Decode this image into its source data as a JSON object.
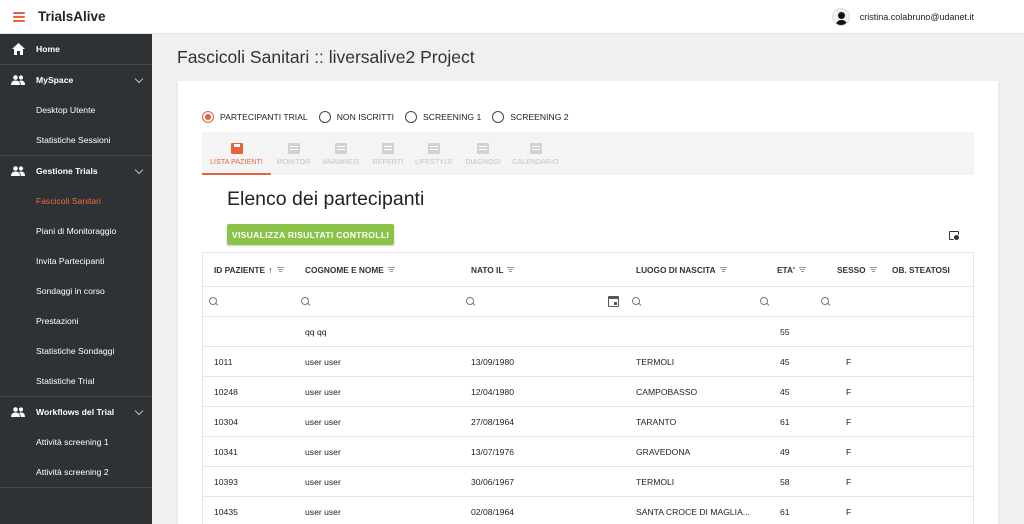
{
  "app": {
    "title": "TrialsAlive"
  },
  "user": {
    "email": "cristina.colabruno@udanet.it"
  },
  "sidebar": {
    "home": "Home",
    "myspace": {
      "label": "MySpace",
      "items": [
        "Desktop Utente",
        "Statistiche Sessioni"
      ]
    },
    "gestione": {
      "label": "Gestione Trials",
      "items": [
        "Fascicoli Sanitari",
        "Piani di Monitoraggio",
        "Invita Partecipanti",
        "Sondaggi in corso",
        "Prestazioni",
        "Statistiche Sondaggi",
        "Statistiche Trial"
      ],
      "active": "Fascicoli Sanitari"
    },
    "workflows": {
      "label": "Workflows del Trial",
      "items": [
        "Attività screening 1",
        "Attività screening 2"
      ]
    }
  },
  "page": {
    "title": "Fascicoli Sanitari :: liversalive2 Project"
  },
  "filters": {
    "options": [
      "PARTECIPANTI TRIAL",
      "NON ISCRITTI",
      "SCREENING 1",
      "SCREENING 2"
    ],
    "selected": "PARTECIPANTI TRIAL"
  },
  "tabs": {
    "items": [
      "LISTA PAZIENTI",
      "MONITOR",
      "ANAMNESI",
      "REFERTI",
      "LIFESTYLE",
      "DIAGNOSI",
      "CALENDARIO"
    ],
    "active": "LISTA PAZIENTI"
  },
  "list": {
    "title": "Elenco dei partecipanti",
    "button_label": "VISUALIZZA RISULTATI CONTROLLI"
  },
  "table": {
    "columns": [
      "ID PAZIENTE",
      "COGNOME E NOME",
      "NATO IL",
      "LUOGO DI NASCITA",
      "ETA'",
      "SESSO",
      "OB. STEATOSI"
    ],
    "sorted_column": "ID PAZIENTE",
    "sort_glyph": "↑",
    "rows": [
      [
        "",
        "qq qq",
        "",
        "",
        "55",
        "",
        ""
      ],
      [
        "1011",
        "user user",
        "13/09/1980",
        "TERMOLI",
        "45",
        "F",
        ""
      ],
      [
        "10248",
        "user user",
        "12/04/1980",
        "CAMPOBASSO",
        "45",
        "F",
        ""
      ],
      [
        "10304",
        "user user",
        "27/08/1964",
        "TARANTO",
        "61",
        "F",
        ""
      ],
      [
        "10341",
        "user user",
        "13/07/1976",
        "GRAVEDONA",
        "49",
        "F",
        ""
      ],
      [
        "10393",
        "user user",
        "30/06/1967",
        "TERMOLI",
        "58",
        "F",
        ""
      ],
      [
        "10435",
        "user user",
        "02/08/1964",
        "SANTA CROCE DI MAGLIA...",
        "61",
        "F",
        ""
      ]
    ]
  },
  "colors": {
    "accent": "#e8623c",
    "sidebar_bg": "#2f3235",
    "button_green": "#8bc34a"
  }
}
